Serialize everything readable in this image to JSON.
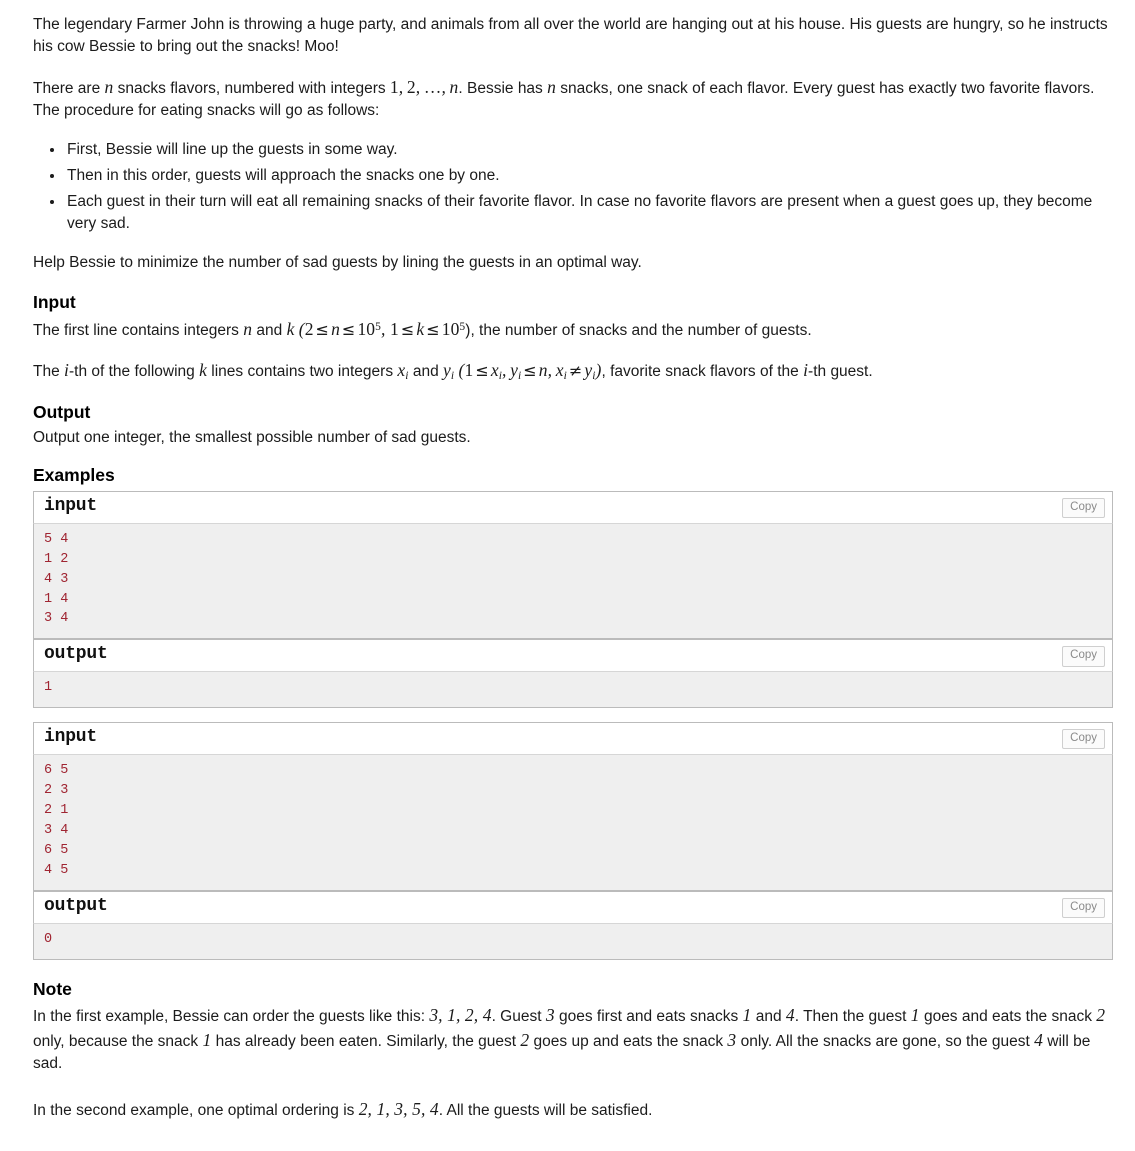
{
  "legend": {
    "paragraph1": "The legendary Farmer John is throwing a huge party, and animals from all over the world are hanging out at his house. His guests are hungry, so he instructs his cow Bessie to bring out the snacks! Moo!",
    "paragraph2_part1": "There are ",
    "paragraph2_part2": " snacks flavors, numbered with integers ",
    "paragraph2_part3": ". Bessie has ",
    "paragraph2_part4": " snacks, one snack of each flavor. Every guest has exactly two favorite flavors. The procedure for eating snacks will go as follows:",
    "steps": [
      "First, Bessie will line up the guests in some way.",
      "Then in this order, guests will approach the snacks one by one.",
      "Each guest in their turn will eat all remaining snacks of their favorite flavor. In case no favorite flavors are present when a guest goes up, they become very sad."
    ],
    "paragraph3": "Help Bessie to minimize the number of sad guests by lining the guests in an optimal way."
  },
  "input_section": {
    "title": "Input",
    "line1_pre": "The first line contains integers ",
    "line1_mid": " and ",
    "line1_constraint_open": "(",
    "line1_n_lower": "2",
    "line1_n_var": "n",
    "line1_n_upper": "10",
    "line1_n_exp": "5",
    "line1_k_lower": "1",
    "line1_k_var": "k",
    "line1_k_upper": "10",
    "line1_k_exp": "5",
    "line1_post": "), the number of snacks and the number of guests.",
    "line2_pre": "The ",
    "line2_ith": "i",
    "line2_mid1": "-th of the following ",
    "line2_k": "k",
    "line2_mid2": " lines contains two integers ",
    "line2_x": "x",
    "line2_and": " and ",
    "line2_y": "y",
    "line2_constraint": "(1 ≤ x_i, y_i ≤ n, x_i ≠ y_i)",
    "line2_post": ", favorite snack flavors of the ",
    "line2_ith2": "i",
    "line2_end": "-th guest."
  },
  "output_section": {
    "title": "Output",
    "text": "Output one integer, the smallest possible number of sad guests."
  },
  "examples_section": {
    "title": "Examples",
    "copy_label": "Copy",
    "input_label": "input",
    "output_label": "output",
    "tests": [
      {
        "input": "5 4\n1 2\n4 3\n1 4\n3 4",
        "output": "1"
      },
      {
        "input": "6 5\n2 3\n2 1\n3 4\n6 5\n4 5",
        "output": "0"
      }
    ]
  },
  "note_section": {
    "title": "Note",
    "paragraph1_a": "In the first example, Bessie can order the guests like this: ",
    "paragraph1_order": "3, 1, 2, 4",
    "paragraph1_b": ". Guest ",
    "paragraph1_g3": "3",
    "paragraph1_c": " goes first and eats snacks ",
    "paragraph1_s1": "1",
    "paragraph1_d": " and ",
    "paragraph1_s4": "4",
    "paragraph1_e": ". Then the guest ",
    "paragraph1_g1": "1",
    "paragraph1_f": " goes and eats the snack ",
    "paragraph1_s2": "2",
    "paragraph1_g": " only, because the snack ",
    "paragraph1_s1b": "1",
    "paragraph1_h": " has already been eaten. Similarly, the guest ",
    "paragraph1_g2": "2",
    "paragraph1_i": " goes up and eats the snack ",
    "paragraph1_s3": "3",
    "paragraph1_j": " only. All the snacks are gone, so the guest ",
    "paragraph1_g4": "4",
    "paragraph1_k": " will be sad.",
    "paragraph2_a": "In the second example, one optimal ordering is ",
    "paragraph2_order": "2, 1, 3, 5, 4",
    "paragraph2_b": ". All the guests will be satisfied."
  },
  "colors": {
    "code_text": "#a02532",
    "code_bg": "#efefef",
    "border": "#bbbbbb",
    "body_text": "#1b1b1b"
  }
}
